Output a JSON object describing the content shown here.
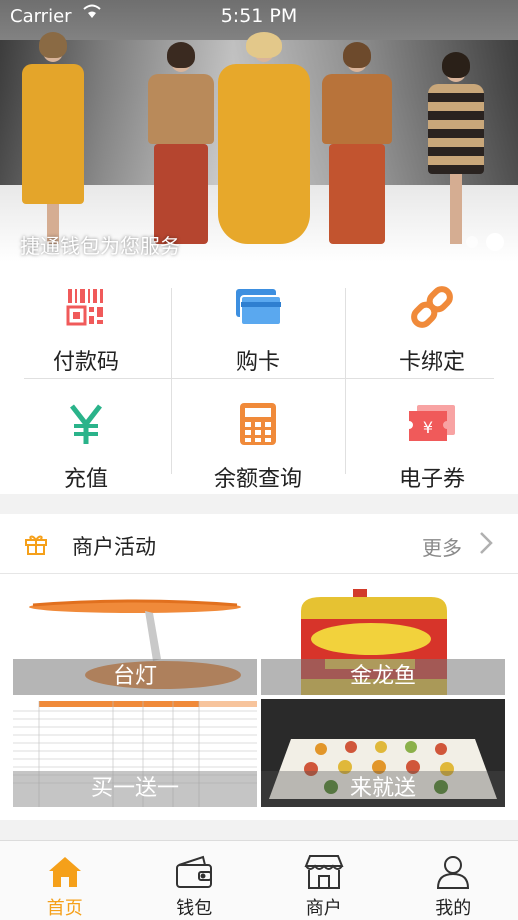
{
  "status_bar": {
    "carrier": "Carrier",
    "time": "5:51 PM"
  },
  "banner": {
    "caption": "捷通钱包为您服务",
    "page_count": 2,
    "active_page": 2
  },
  "colors": {
    "accent": "#f5a01a",
    "red": "#f05a5a",
    "blue": "#3d8fe0",
    "orange": "#f08a3a",
    "green": "#2ab38a"
  },
  "grid": {
    "items": [
      {
        "label": "付款码",
        "icon": "qr-code-icon"
      },
      {
        "label": "购卡",
        "icon": "cards-icon"
      },
      {
        "label": "卡绑定",
        "icon": "link-icon"
      },
      {
        "label": "充值",
        "icon": "yen-icon"
      },
      {
        "label": "余额查询",
        "icon": "calculator-icon"
      },
      {
        "label": "电子券",
        "icon": "coupon-icon"
      }
    ]
  },
  "activity": {
    "title": "商户活动",
    "more": "更多",
    "tiles": [
      {
        "caption": "台灯"
      },
      {
        "caption": "金龙鱼"
      },
      {
        "caption": "买一送一"
      },
      {
        "caption": "来就送"
      }
    ]
  },
  "tabbar": {
    "items": [
      {
        "label": "首页",
        "icon": "home-icon",
        "active": true
      },
      {
        "label": "钱包",
        "icon": "wallet-icon",
        "active": false
      },
      {
        "label": "商户",
        "icon": "store-icon",
        "active": false
      },
      {
        "label": "我的",
        "icon": "profile-icon",
        "active": false
      }
    ]
  }
}
